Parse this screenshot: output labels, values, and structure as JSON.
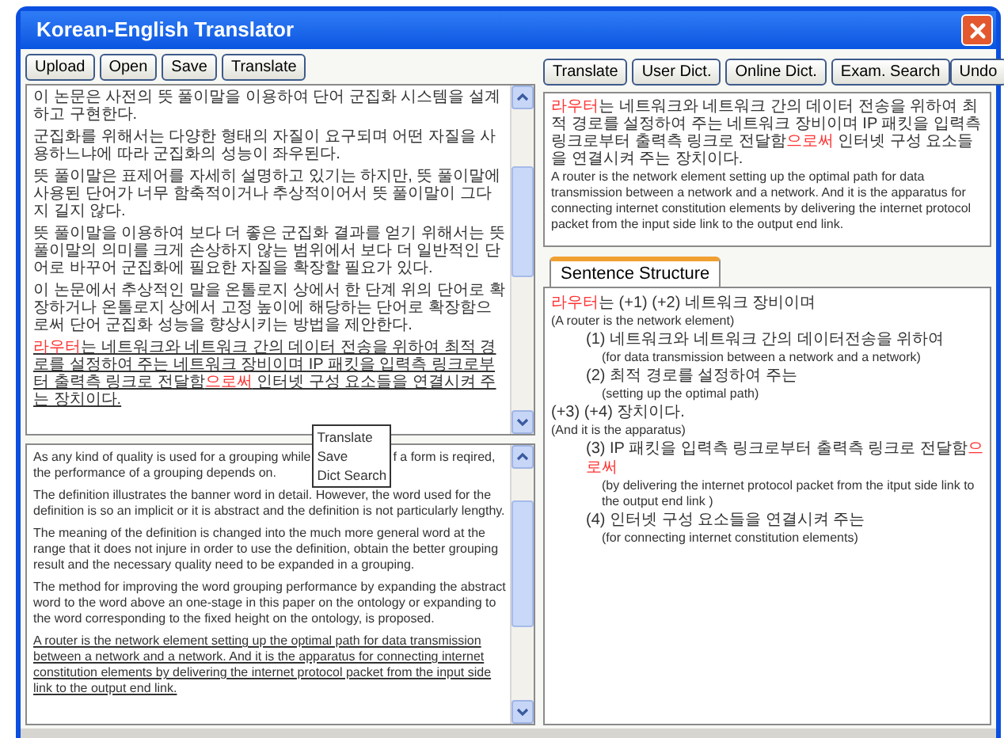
{
  "window": {
    "title": "Korean-English Translator"
  },
  "left_toolbar": [
    "Upload",
    "Open",
    "Save",
    "Translate"
  ],
  "right_toolbar": [
    "Translate",
    "User Dict.",
    "Online Dict.",
    "Exam. Search"
  ],
  "undo": "Undo",
  "source_panel": {
    "paragraphs": [
      {
        "underlined": false,
        "segments": [
          {
            "text": "이 논문은 사전의 뜻 풀이말을 이용하여 단어 군집화 시스템을 설계하고 구현한다.",
            "highlight": false
          }
        ]
      },
      {
        "underlined": false,
        "segments": [
          {
            "text": "군집화를 위해서는 다양한 형태의 자질이 요구되며 어떤 자질을 사용하느냐에 따라 군집화의 성능이 좌우된다.",
            "highlight": false
          }
        ]
      },
      {
        "underlined": false,
        "segments": [
          {
            "text": "뜻 풀이말은 표제어를 자세히 설명하고 있기는 하지만, 뜻 풀이말에 사용된 단어가 너무 함축적이거나 추상적이어서 뜻 풀이말이 그다지 길지 않다.",
            "highlight": false
          }
        ]
      },
      {
        "underlined": false,
        "segments": [
          {
            "text": "뜻 풀이말을 이용하여 보다 더 좋은 군집화 결과를 얻기 위해서는 뜻 풀이말의 의미를 크게 손상하지 않는 범위에서 보다 더 일반적인 단어로 바꾸어 군집화에 필요한 자질을 확장할 필요가 있다.",
            "highlight": false
          }
        ]
      },
      {
        "underlined": false,
        "segments": [
          {
            "text": "이 논문에서 추상적인 말을 온톨로지 상에서 한 단계 위의 단어로 확장하거나 온톨로지 상에서 고정 높이에 해당하는 단어로 확장함으로써 단어 군집화 성능을 향상시키는 방법을 제안한다.",
            "highlight": false
          }
        ]
      },
      {
        "underlined": true,
        "segments": [
          {
            "text": "라우터",
            "highlight": true
          },
          {
            "text": "는 네트워크와 네트워크 간의 데이터 전송을 위하여 최적 경로를 설정하여 주는 네트워크 장비이며 IP 패킷을 입력측 링크로부터 출력측 링크로 전달함",
            "highlight": false
          },
          {
            "text": "으로써",
            "highlight": true
          },
          {
            "text": " 인터넷 구성 요소들을 연결시켜 주는 장치이다.",
            "highlight": false
          }
        ]
      }
    ]
  },
  "context_menu": [
    "Translate",
    "Save",
    "Dict Search"
  ],
  "target_panel": {
    "first_paragraph": {
      "line_1_left": "As any kind of quality is used for a grouping while",
      "line_1_right": "f a form is reqired,",
      "line_2": "the performance of a grouping depends on."
    },
    "paragraphs": [
      {
        "underlined": false,
        "text": "The definition illustrates the banner word in detail. However, the word used for the definition is so an implicit or it is abstract and the definition is not particularly lengthy."
      },
      {
        "underlined": false,
        "text": "The meaning of the definition is changed into the much more general word at the range that it does not injure in order to use the definition, obtain the better grouping result and the necessary quality need to be expanded in a grouping."
      },
      {
        "underlined": false,
        "text": "The method for improving the word grouping performance by expanding the abstract word to the word above an one-stage in this paper on the ontology or expanding to the word corresponding to the fixed height on the ontology, is proposed."
      },
      {
        "underlined": true,
        "text": "A router is the network element setting up the optimal path for data transmission between a network and a network. And it is the apparatus for connecting internet constitution elements by delivering the internet protocol packet from the input side link to the output end link."
      }
    ]
  },
  "translation_panel": {
    "korean": [
      {
        "text": "라우터",
        "highlight": true
      },
      {
        "text": "는 네트워크와 네트워크 간의 데이터 전송을 위하여 최적 경로를 설정하여 주는 네트워크 장비이며 IP 패킷을 입력측 링크로부터 출력측 링크로 전달함",
        "highlight": false
      },
      {
        "text": "으로써",
        "highlight": true
      },
      {
        "text": " 인터넷 구성 요소들을 연결시켜 주는 장치이다.",
        "highlight": false
      }
    ],
    "english": "A router is the network element setting up the optimal path for data transmission between a network and a network. And it is the apparatus for connecting internet constitution elements by delivering the internet protocol packet from the input side link to the output end link."
  },
  "structure_tab": {
    "label": "Sentence Structure",
    "selected": true
  },
  "sentence_structure": [
    {
      "korean": [
        {
          "text": "라우터",
          "highlight": true
        },
        {
          "text": "는 (+1) (+2) 네트워크 장비이며",
          "highlight": false
        }
      ],
      "english": "(A router is the network element)",
      "children": [
        {
          "korean": [
            {
              "text": "(1) 네트워크와 네트워크 간의 데이터전송을 위하여",
              "highlight": false
            }
          ],
          "english": "(for data transmission between a network and a network)"
        },
        {
          "korean": [
            {
              "text": "(2) 최적 경로를 설정하여 주는",
              "highlight": false
            }
          ],
          "english": "(setting up the optimal path)"
        }
      ]
    },
    {
      "korean": [
        {
          "text": "(+3) (+4) 장치이다.",
          "highlight": false
        }
      ],
      "english": "(And it is the apparatus)",
      "children": [
        {
          "korean": [
            {
              "text": "(3) IP 패킷을 입력측 링크로부터 출력측 링크로 전달함",
              "highlight": false
            },
            {
              "text": "으로써",
              "highlight": true
            }
          ],
          "english": "(by delivering the internet protocol packet from the itput side link to the output end link )"
        },
        {
          "korean": [
            {
              "text": "(4) 인터넷 구성 요소들을 연결시켜 주는",
              "highlight": false
            }
          ],
          "english": "(for connecting internet constitution elements)"
        }
      ]
    }
  ]
}
